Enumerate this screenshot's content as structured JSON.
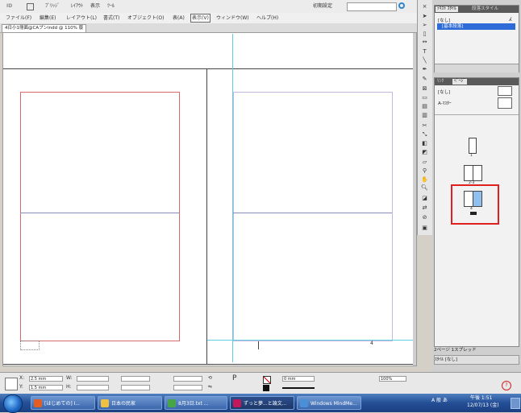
{
  "app": {
    "logo": "ID",
    "topbar_items": [
      "ﾌﾞﾘｯｼﾞ",
      "ﾚｲｱｳﾄ",
      "表示",
      "ﾂｰﾙ"
    ],
    "search_placeholder": "",
    "workspace": "初期設定"
  },
  "menu": {
    "items": [
      "ファイル(F)",
      "編集(E)",
      "レイアウト(L)",
      "書式(T)",
      "オブジェクト(O)",
      "表(A)",
      "表示(V)",
      "ウィンドウ(W)",
      "ヘルプ(H)"
    ],
    "active_index": 6
  },
  "document": {
    "tab_label": "4日小1冊面@CAプンindd @ 110% 版"
  },
  "page_marker": "4",
  "panels": {
    "top": {
      "tabs": [
        "ﾃｷｽﾄ ｽﾀｲﾙ",
        "段落スタイル"
      ],
      "rows": [
        "[なし]",
        "[基本段落]"
      ],
      "selected_index": 1
    },
    "pages": {
      "tabs": [
        "ﾘﾝｸ",
        "ﾍﾟｰｼﾞ"
      ],
      "rows": [
        "[なし]",
        "A-ﾏｽﾀｰ"
      ],
      "spread_labels": [
        "1",
        "2-3",
        "4"
      ],
      "highlight_color": "#e02020"
    },
    "bottom_text": "2ページ 1スプレッド",
    "bottom_dropdown": "ｽﾀｲﾙ [なし]"
  },
  "controlbar": {
    "x_label": "X:",
    "y_label": "Y:",
    "w_label": "W:",
    "h_label": "H:",
    "x_value": "2.5 mm",
    "y_value": "1.5 mm",
    "zoom": "100%",
    "stroke_weight": "0 mm"
  },
  "taskbar": {
    "tasks": [
      {
        "label": "[はじめての] I...",
        "color": "#e35d24"
      },
      {
        "label": "日本の民家",
        "color": "#f0c040"
      },
      {
        "label": "8月3日.txt ...",
        "color": "#47a447"
      },
      {
        "label": "ずっと夢...と論文...",
        "color": "#c2185b"
      },
      {
        "label": "Windows MindMe...",
        "color": "#4a90d9"
      }
    ],
    "active_index": 3,
    "tray_text": "A 般 あ",
    "time": "午後 1:51",
    "date": "12/07/13 (金)"
  }
}
